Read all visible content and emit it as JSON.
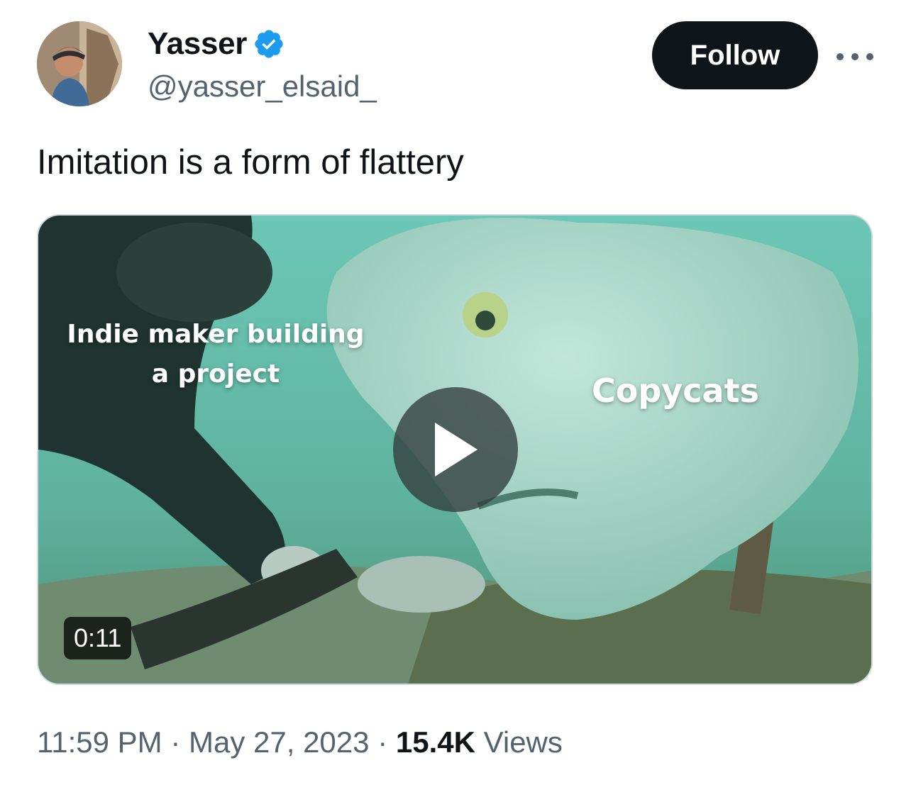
{
  "author": {
    "display_name": "Yasser",
    "handle": "@yasser_elsaid_",
    "verified": true,
    "verified_color": "#1d9bf0",
    "avatar_icon": "profile-photo"
  },
  "actions": {
    "follow_label": "Follow",
    "more_icon": "more-options-icon"
  },
  "tweet": {
    "text": "Imitation is a form of flattery"
  },
  "media": {
    "caption_left": "Indie maker building a project",
    "caption_right": "Copycats",
    "duration": "0:11",
    "play_icon": "play-icon"
  },
  "meta": {
    "time": "11:59 PM",
    "separator": "·",
    "date": "May 27, 2023",
    "views_count": "15.4K",
    "views_label": "Views"
  },
  "colors": {
    "text_primary": "#0f1419",
    "text_secondary": "#536471",
    "follow_bg": "#0f1419",
    "accent": "#1d9bf0"
  }
}
